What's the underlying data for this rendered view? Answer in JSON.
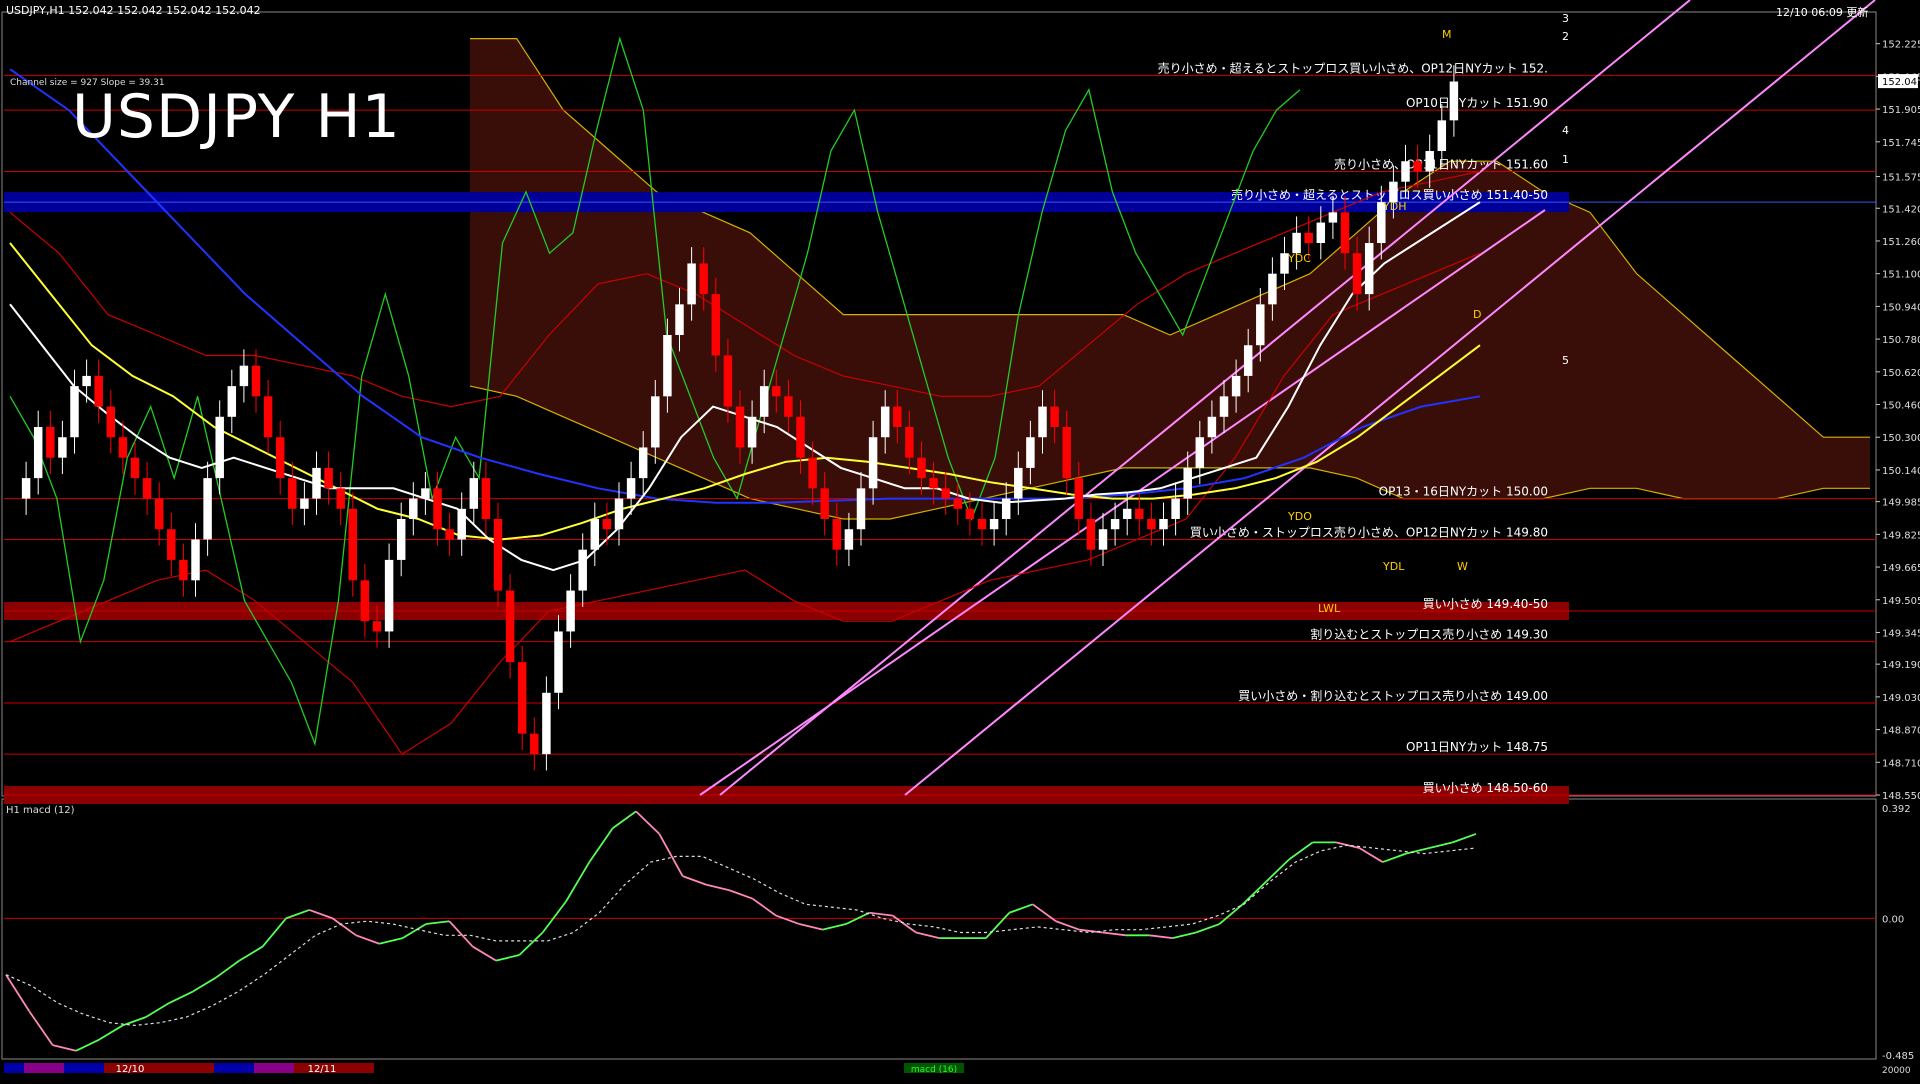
{
  "header": {
    "symbol_info": "USDJPY,H1  152.042 152.042 152.042 152.042",
    "timestamp": "12/10 06:09 更新"
  },
  "main_title": "USDJPY H1",
  "channel_info": "Channel size = 927 Slope = 39.31",
  "current_price_badge": "152.042",
  "colors": {
    "background": "#000000",
    "bull_candle": "#ffffff",
    "bear_candle": "#ff0000",
    "sma_white": "#ffffff",
    "sma_yellow": "#ffff33",
    "sma_blue": "#2233ff",
    "bollinger": "#cc0000",
    "chikou": "#22cc22",
    "cloud": "#cc3322",
    "channel": "#ff88ff",
    "macd_up": "#55ff55",
    "macd_down": "#ff88bb",
    "zone_red": "#8b0000",
    "zone_blue": "#000099",
    "zone_text": "#ffffff"
  },
  "chart_data": {
    "type": "candlestick",
    "symbol": "USDJPY",
    "timeframe": "H1",
    "ylim": [
      148.55,
      152.38
    ],
    "y_ticks": [
      "152.225",
      "152.065",
      "151.905",
      "151.745",
      "151.575",
      "151.420",
      "151.260",
      "151.100",
      "150.940",
      "150.780",
      "150.620",
      "150.460",
      "150.300",
      "150.140",
      "149.985",
      "149.825",
      "149.665",
      "149.505",
      "149.345",
      "149.190",
      "149.030",
      "148.870",
      "148.710",
      "148.550"
    ],
    "x_labels": [
      "12/10",
      "12/11"
    ],
    "close_series": [
      150.0,
      150.1,
      150.35,
      150.2,
      150.3,
      150.55,
      150.6,
      150.45,
      150.3,
      150.2,
      150.1,
      150.0,
      149.85,
      149.7,
      149.6,
      149.8,
      150.1,
      150.4,
      150.55,
      150.65,
      150.5,
      150.3,
      150.1,
      149.95,
      150.0,
      150.15,
      150.05,
      149.95,
      149.6,
      149.4,
      149.35,
      149.7,
      149.9,
      150.0,
      150.05,
      149.85,
      149.8,
      149.95,
      150.1,
      149.9,
      149.55,
      149.2,
      148.85,
      148.75,
      149.05,
      149.35,
      149.55,
      149.75,
      149.9,
      149.85,
      150.0,
      150.1,
      150.25,
      150.5,
      150.8,
      150.95,
      151.15,
      151.0,
      150.7,
      150.45,
      150.25,
      150.4,
      150.55,
      150.5,
      150.4,
      150.2,
      150.05,
      149.9,
      149.75,
      149.85,
      150.05,
      150.3,
      150.45,
      150.35,
      150.2,
      150.1,
      150.05,
      150.0,
      149.95,
      149.9,
      149.85,
      149.9,
      150.0,
      150.15,
      150.3,
      150.45,
      150.35,
      150.1,
      149.9,
      149.75,
      149.85,
      149.9,
      149.95,
      149.9,
      149.85,
      149.9,
      150.0,
      150.15,
      150.3,
      150.4,
      150.5,
      150.6,
      150.75,
      150.95,
      151.1,
      151.2,
      151.3,
      151.25,
      151.35,
      151.4,
      151.2,
      151.0,
      151.25,
      151.45,
      151.55,
      151.65,
      151.6,
      151.7,
      151.85,
      152.04
    ],
    "sma_white": [
      150.95,
      150.75,
      150.55,
      150.42,
      150.3,
      150.2,
      150.15,
      150.2,
      150.15,
      150.1,
      150.05,
      150.05,
      150.05,
      150.0,
      149.95,
      149.8,
      149.7,
      149.65,
      149.7,
      149.85,
      150.05,
      150.3,
      150.45,
      150.4,
      150.35,
      150.25,
      150.15,
      150.1,
      150.05,
      150.05,
      150.0,
      149.98,
      149.99,
      150.0,
      150.02,
      150.03,
      150.05,
      150.1,
      150.15,
      150.2,
      150.45,
      150.75,
      151.0,
      151.15,
      151.25,
      151.35,
      151.45
    ],
    "sma_yellow": [
      151.25,
      151.0,
      150.75,
      150.6,
      150.5,
      150.35,
      150.25,
      150.15,
      150.05,
      149.95,
      149.9,
      149.82,
      149.8,
      149.82,
      149.88,
      149.95,
      150.0,
      150.05,
      150.12,
      150.18,
      150.2,
      150.18,
      150.15,
      150.12,
      150.08,
      150.05,
      150.02,
      150.0,
      150.0,
      150.02,
      150.05,
      150.1,
      150.18,
      150.3,
      150.45,
      150.6,
      150.75
    ],
    "sma_blue": [
      152.1,
      151.9,
      151.6,
      151.3,
      151.0,
      150.75,
      150.5,
      150.3,
      150.2,
      150.12,
      150.05,
      150.0,
      149.98,
      149.98,
      149.99,
      150.0,
      150.0,
      150.0,
      150.0,
      150.02,
      150.05,
      150.1,
      150.2,
      150.35,
      150.45,
      150.5
    ],
    "chikou": [
      150.5,
      150.3,
      150.0,
      149.3,
      149.6,
      150.2,
      150.45,
      150.1,
      150.5,
      150.0,
      149.5,
      149.3,
      149.1,
      148.8,
      149.5,
      150.6,
      151.0,
      150.6,
      150.0,
      150.3,
      150.1,
      151.25,
      151.5,
      151.2,
      151.3,
      151.8,
      152.25,
      151.9,
      150.8,
      150.5,
      150.2,
      150.0,
      150.4,
      150.8,
      151.2,
      151.7,
      151.9,
      151.4,
      151.0,
      150.6,
      150.2,
      149.9,
      150.2,
      150.9,
      151.4,
      151.8,
      152.0,
      151.5,
      151.2,
      151.0,
      150.8,
      151.1,
      151.4,
      151.7,
      151.9,
      152.0
    ],
    "bollinger_upper": [
      151.4,
      151.2,
      150.9,
      150.8,
      150.7,
      150.7,
      150.65,
      150.6,
      150.5,
      150.45,
      150.5,
      150.8,
      151.05,
      151.1,
      151.0,
      150.85,
      150.7,
      150.6,
      150.55,
      150.5,
      150.5,
      150.55,
      150.75,
      150.95,
      151.1,
      151.2,
      151.3,
      151.4,
      151.5,
      151.55,
      151.6
    ],
    "bollinger_lower": [
      149.3,
      149.4,
      149.5,
      149.6,
      149.65,
      149.5,
      149.3,
      149.1,
      148.75,
      148.9,
      149.2,
      149.45,
      149.5,
      149.55,
      149.6,
      149.65,
      149.5,
      149.4,
      149.4,
      149.5,
      149.6,
      149.65,
      149.7,
      149.8,
      149.9,
      150.2,
      150.6,
      150.9,
      151.0,
      151.1,
      151.2
    ],
    "cloud_top": [
      152.25,
      152.25,
      151.9,
      151.7,
      151.5,
      151.4,
      151.3,
      151.1,
      150.9,
      150.9,
      150.9,
      150.9,
      150.9,
      150.9,
      150.9,
      150.8,
      150.9,
      151.0,
      151.1,
      151.3,
      151.5,
      151.65,
      151.65,
      151.5,
      151.4,
      151.1,
      150.9,
      150.7,
      150.5,
      150.3,
      150.3
    ],
    "cloud_bottom": [
      150.55,
      150.5,
      150.4,
      150.3,
      150.2,
      150.1,
      150.0,
      149.95,
      149.9,
      149.9,
      149.95,
      150.0,
      150.05,
      150.1,
      150.15,
      150.15,
      150.15,
      150.15,
      150.15,
      150.1,
      150.0,
      150.0,
      150.0,
      150.0,
      150.05,
      150.05,
      150.0,
      150.0,
      150.0,
      150.05,
      150.05
    ],
    "horizontal_levels": [
      {
        "price": 152.07,
        "label": "売り小さめ・超えるとストップロス買い小さめ、OP12日NYカット 152."
      },
      {
        "price": 151.9,
        "label": "OP10日NYカット 151.90"
      },
      {
        "price": 151.6,
        "label": "売り小さめ、OP11日NYカット 151.60"
      },
      {
        "price": 151.45,
        "label": "売り小さめ・超えるとストップロス買い小さめ 151.40-50",
        "zone": "blue"
      },
      {
        "price": 150.0,
        "label": "OP13・16日NYカット 150.00"
      },
      {
        "price": 149.8,
        "label": "買い小さめ・ストップロス売り小さめ、OP12日NYカット 149.80"
      },
      {
        "price": 149.45,
        "label": "買い小さめ 149.40-50",
        "zone": "red"
      },
      {
        "price": 149.3,
        "label": "割り込むとストップロス売り小さめ 149.30"
      },
      {
        "price": 149.0,
        "label": "買い小さめ・割り込むとストップロス売り小さめ 149.00"
      },
      {
        "price": 148.75,
        "label": "OP11日NYカット 148.75"
      },
      {
        "price": 148.55,
        "label": "買い小さめ 148.50-60",
        "zone": "red"
      }
    ],
    "markers": [
      "YDC",
      "YDH",
      "YDO",
      "YDL",
      "LWL",
      "W",
      "M",
      "D",
      "1",
      "2",
      "3",
      "4",
      "5"
    ],
    "macd": {
      "label": "H1  macd (12)",
      "ylim": [
        -0.485,
        0.392
      ],
      "y_ticks": [
        "0.392",
        "0.00",
        "-0.485"
      ],
      "bottom_tick": "20000",
      "main": [
        -0.2,
        -0.33,
        -0.45,
        -0.47,
        -0.43,
        -0.38,
        -0.35,
        -0.3,
        -0.26,
        -0.21,
        -0.15,
        -0.1,
        0.0,
        0.03,
        0.0,
        -0.06,
        -0.09,
        -0.07,
        -0.02,
        -0.01,
        -0.1,
        -0.15,
        -0.13,
        -0.05,
        0.06,
        0.2,
        0.32,
        0.38,
        0.3,
        0.15,
        0.12,
        0.1,
        0.07,
        0.01,
        -0.02,
        -0.04,
        -0.02,
        0.02,
        0.01,
        -0.05,
        -0.07,
        -0.07,
        -0.07,
        0.02,
        0.05,
        -0.01,
        -0.04,
        -0.05,
        -0.06,
        -0.06,
        -0.07,
        -0.05,
        -0.02,
        0.05,
        0.13,
        0.21,
        0.27,
        0.27,
        0.25,
        0.2,
        0.23,
        0.25,
        0.27,
        0.3
      ],
      "signal": [
        -0.2,
        -0.24,
        -0.3,
        -0.34,
        -0.37,
        -0.38,
        -0.37,
        -0.35,
        -0.31,
        -0.26,
        -0.2,
        -0.13,
        -0.06,
        -0.02,
        -0.01,
        -0.02,
        -0.04,
        -0.06,
        -0.06,
        -0.08,
        -0.08,
        -0.08,
        -0.05,
        0.02,
        0.12,
        0.2,
        0.22,
        0.22,
        0.18,
        0.14,
        0.09,
        0.05,
        0.04,
        0.03,
        0.0,
        -0.02,
        -0.03,
        -0.05,
        -0.05,
        -0.04,
        -0.03,
        -0.04,
        -0.05,
        -0.04,
        -0.04,
        -0.03,
        -0.02,
        0.01,
        0.05,
        0.13,
        0.2,
        0.24,
        0.26,
        0.25,
        0.24,
        0.23,
        0.24,
        0.25
      ]
    },
    "bottom_strip_label": "macd (16)"
  }
}
